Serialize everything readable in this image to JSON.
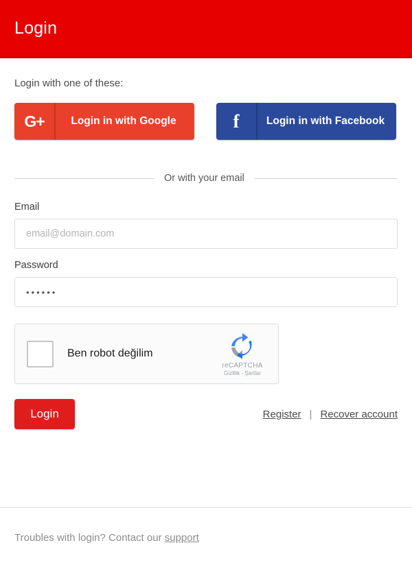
{
  "header": {
    "title": "Login",
    "bg_color": "#e60000"
  },
  "main": {
    "intro": "Login with one of these:",
    "social_buttons": [
      {
        "label": "Login in with Google",
        "icon": "google-plus-icon",
        "glyph": "G+",
        "color": "#e8402a"
      },
      {
        "label": "Login in with Facebook",
        "icon": "facebook-icon",
        "glyph": "f",
        "color": "#2b4a9b"
      }
    ],
    "divider_text": "Or with your email",
    "email": {
      "label": "Email",
      "placeholder": "email@domain.com",
      "value": ""
    },
    "password": {
      "label": "Password",
      "placeholder": "",
      "value": "••••••"
    },
    "recaptcha": {
      "label": "Ben robot değilim",
      "brand": "reCAPTCHA",
      "terms": "Gizlilik - Şartlar",
      "checked": false
    },
    "submit_label": "Login",
    "links": {
      "register": "Register",
      "separator": "|",
      "recover": "Recover account"
    }
  },
  "footer": {
    "text": "Troubles with login? Contact our ",
    "link": "support"
  }
}
